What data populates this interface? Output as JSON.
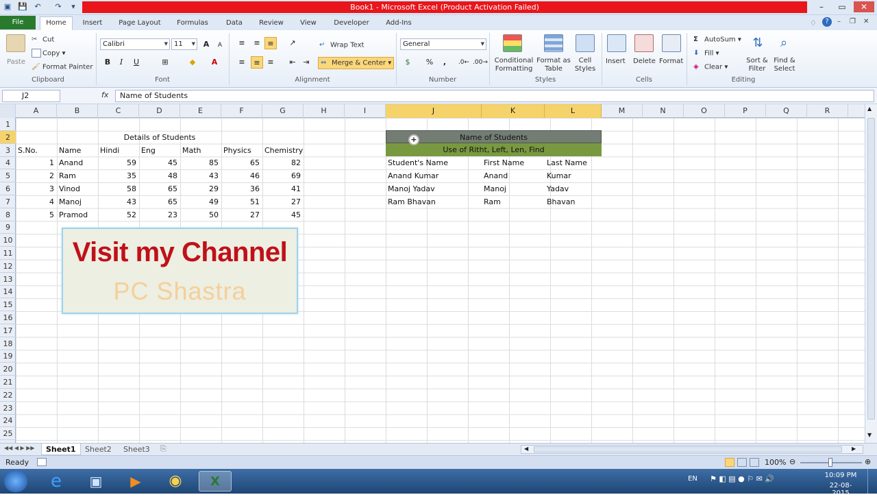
{
  "window": {
    "title": "Book1  -  Microsoft Excel (Product Activation Failed)"
  },
  "tabs": [
    "File",
    "Home",
    "Insert",
    "Page Layout",
    "Formulas",
    "Data",
    "Review",
    "View",
    "Developer",
    "Add-Ins"
  ],
  "ribbon": {
    "clipboard": {
      "label": "Clipboard",
      "paste": "Paste",
      "cut": "Cut",
      "copy": "Copy",
      "format_painter": "Format Painter"
    },
    "font": {
      "label": "Font",
      "font_name": "Calibri",
      "font_size": "11",
      "bold": "B",
      "italic": "I",
      "underline": "U",
      "grow": "A",
      "shrink": "A"
    },
    "alignment": {
      "label": "Alignment",
      "wrap_text": "Wrap Text",
      "merge_center": "Merge & Center"
    },
    "number": {
      "label": "Number",
      "format": "General",
      "percent": "%",
      "comma": ","
    },
    "styles": {
      "label": "Styles",
      "conditional": "Conditional Formatting",
      "format_table": "Format as Table",
      "cell_styles": "Cell Styles"
    },
    "cells": {
      "label": "Cells",
      "insert": "Insert",
      "delete": "Delete",
      "format": "Format"
    },
    "editing": {
      "label": "Editing",
      "autosum": "AutoSum",
      "fill": "Fill",
      "clear": "Clear",
      "sort_filter": "Sort & Filter",
      "find_select": "Find & Select"
    }
  },
  "formula_bar": {
    "name_box": "J2",
    "fx": "fx",
    "value": "Name of Students"
  },
  "columns": [
    "A",
    "B",
    "C",
    "D",
    "E",
    "F",
    "G",
    "H",
    "I",
    "J",
    "K",
    "L",
    "M",
    "N",
    "O",
    "P",
    "Q",
    "R"
  ],
  "rows": [
    "1",
    "2",
    "3",
    "4",
    "5",
    "6",
    "7",
    "8",
    "9",
    "10",
    "11",
    "12",
    "13",
    "14",
    "15",
    "16",
    "17",
    "18",
    "19",
    "20",
    "21",
    "22",
    "23",
    "24",
    "25"
  ],
  "table1": {
    "title": "Details of Students",
    "headers": [
      "S.No.",
      "Name",
      "Hindi",
      "Eng",
      "Math",
      "Physics",
      "Chemistry"
    ],
    "rows": [
      [
        "1",
        "Anand",
        "59",
        "45",
        "85",
        "65",
        "82"
      ],
      [
        "2",
        "Ram",
        "35",
        "48",
        "43",
        "46",
        "69"
      ],
      [
        "3",
        "Vinod",
        "58",
        "65",
        "29",
        "36",
        "41"
      ],
      [
        "4",
        "Manoj",
        "43",
        "65",
        "49",
        "51",
        "27"
      ],
      [
        "5",
        "Pramod",
        "52",
        "23",
        "50",
        "27",
        "45"
      ]
    ]
  },
  "table2": {
    "title": "Name of Students",
    "subtitle": "Use of Ritht, Left, Len, Find",
    "headers": [
      "Student's Name",
      "First Name",
      "Last Name"
    ],
    "rows": [
      [
        "Anand Kumar",
        "Anand",
        "Kumar"
      ],
      [
        "Manoj Yadav",
        "Manoj",
        "Yadav"
      ],
      [
        "Ram Bhavan",
        "Ram",
        "Bhavan"
      ]
    ]
  },
  "banner": {
    "title": "Visit my Channel",
    "subtitle": "PC Shastra"
  },
  "sheets": [
    "Sheet1",
    "Sheet2",
    "Sheet3"
  ],
  "status": {
    "ready": "Ready",
    "zoom": "100%"
  },
  "taskbar": {
    "lang": "EN",
    "time": "10:09 PM",
    "date": "22-08-2015"
  },
  "colors": {
    "title_red": "#e8161b",
    "merged_green": "#789940",
    "selection_header": "#f5d36a",
    "banner_red": "#c0101a"
  }
}
